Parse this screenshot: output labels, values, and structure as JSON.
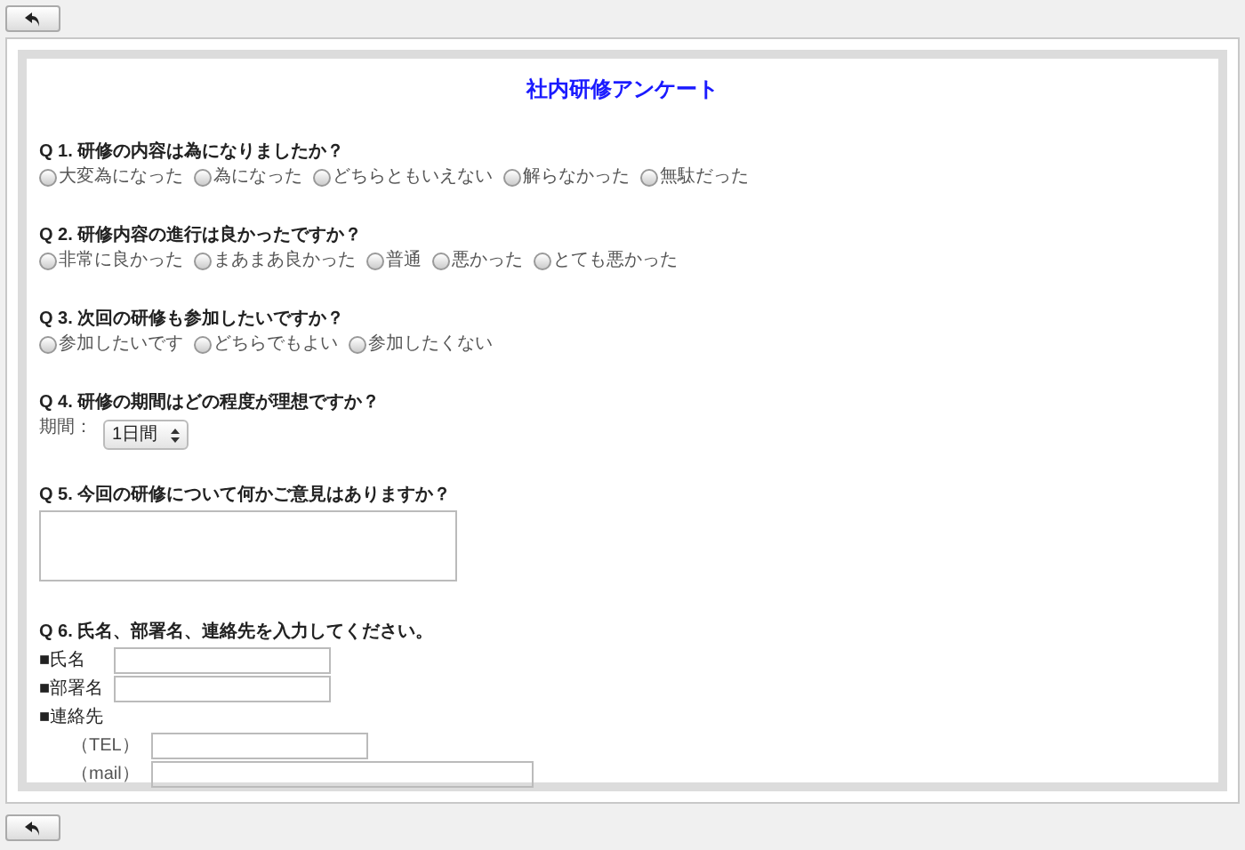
{
  "title": "社内研修アンケート",
  "questions": [
    {
      "kind": "radio",
      "label": "Q 1. 研修の内容は為になりましたか？",
      "options": [
        {
          "label": "大変為になった",
          "selected": false
        },
        {
          "label": "為になった",
          "selected": false
        },
        {
          "label": "どちらともいえない",
          "selected": false
        },
        {
          "label": "解らなかった",
          "selected": false
        },
        {
          "label": "無駄だった",
          "selected": false
        }
      ]
    },
    {
      "kind": "radio",
      "label": "Q 2. 研修内容の進行は良かったですか？",
      "options": [
        {
          "label": "非常に良かった",
          "selected": false
        },
        {
          "label": "まあまあ良かった",
          "selected": false
        },
        {
          "label": "普通",
          "selected": false
        },
        {
          "label": "悪かった",
          "selected": false
        },
        {
          "label": "とても悪かった",
          "selected": false
        }
      ]
    },
    {
      "kind": "radio",
      "label": "Q 3. 次回の研修も参加したいですか？",
      "options": [
        {
          "label": "参加したいです",
          "selected": false
        },
        {
          "label": "どちらでもよい",
          "selected": false
        },
        {
          "label": "参加したくない",
          "selected": false
        }
      ]
    },
    {
      "kind": "select",
      "label": "Q 4. 研修の期間はどの程度が理想ですか？",
      "field_label": "期間：",
      "value": "1日間"
    },
    {
      "kind": "textarea",
      "label": "Q 5. 今回の研修について何かご意見はありますか？"
    },
    {
      "kind": "contact",
      "label": "Q 6. 氏名、部署名、連絡先を入力してください。",
      "fields": [
        {
          "kind": "field",
          "label": "■氏名"
        },
        {
          "kind": "field",
          "label": "■部署名"
        },
        {
          "kind": "heading",
          "label": "■連絡先"
        },
        {
          "kind": "subfield",
          "label": "（TEL）"
        },
        {
          "kind": "subfield",
          "label": "（mail）"
        }
      ]
    }
  ]
}
